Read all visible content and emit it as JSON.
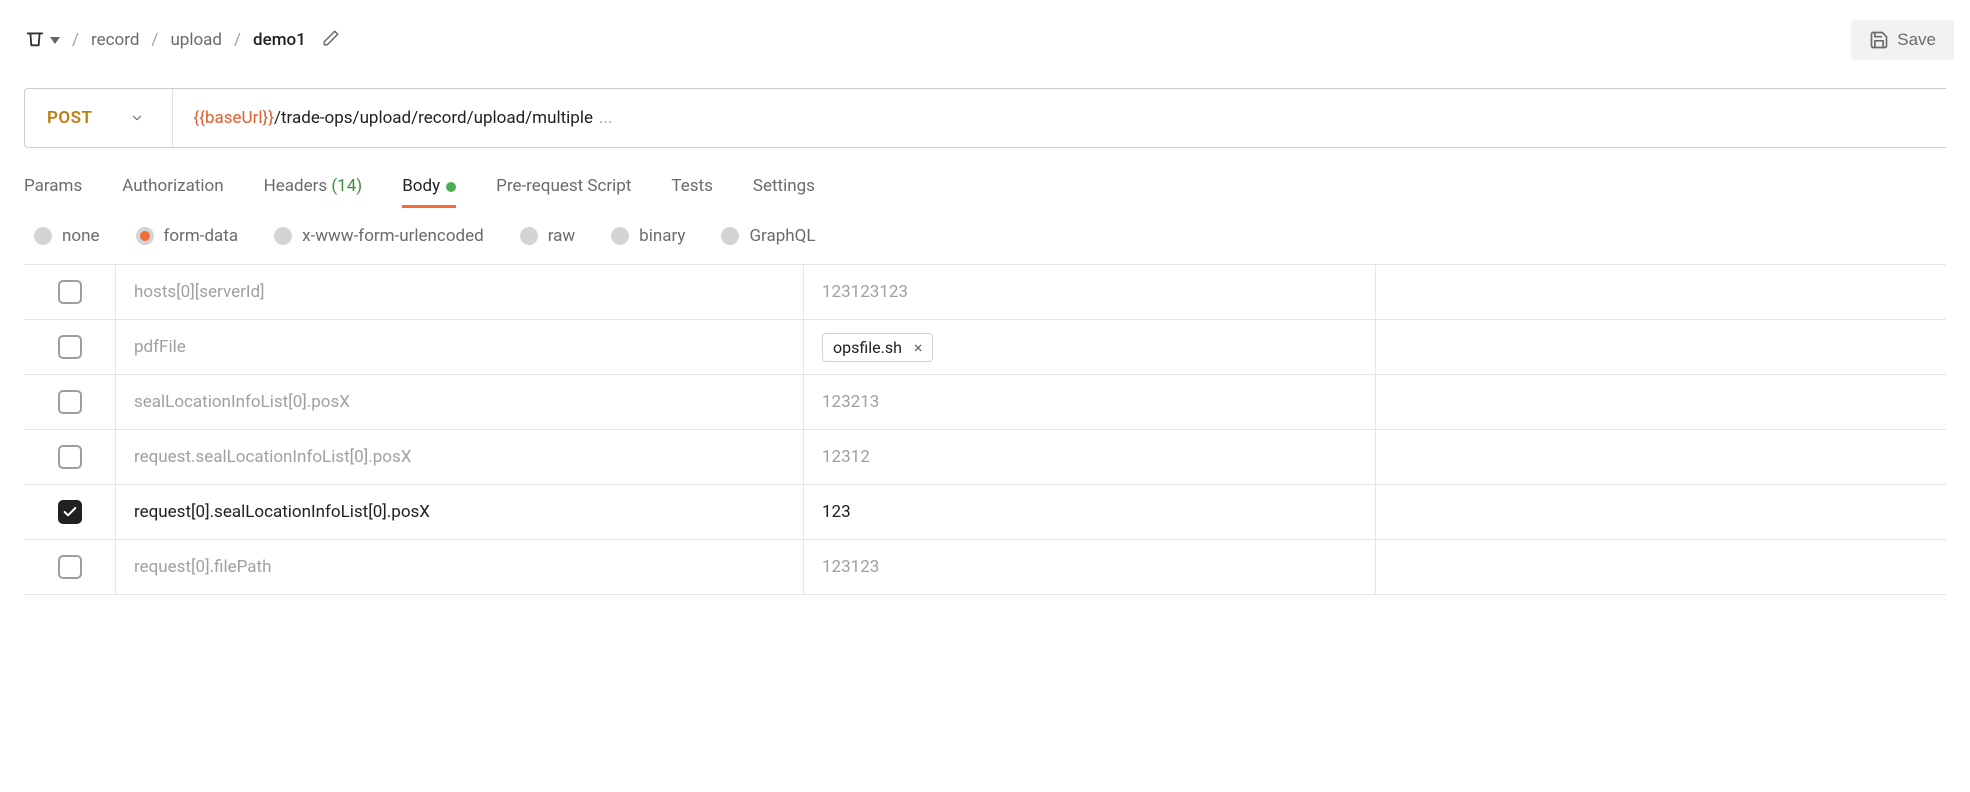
{
  "breadcrumb": {
    "items": [
      "record",
      "upload",
      "demo1"
    ]
  },
  "save_label": "Save",
  "request": {
    "method": "POST",
    "url_var": "{{baseUrl}}",
    "url_path": "/trade-ops/upload/record/upload/multiple",
    "url_ellipsis": "..."
  },
  "tabs": {
    "params": "Params",
    "authorization": "Authorization",
    "headers": "Headers",
    "headers_count": "(14)",
    "body": "Body",
    "prerequest": "Pre-request Script",
    "tests": "Tests",
    "settings": "Settings",
    "active": "body"
  },
  "body_types": {
    "none": "none",
    "form_data": "form-data",
    "urlencoded": "x-www-form-urlencoded",
    "raw": "raw",
    "binary": "binary",
    "graphql": "GraphQL",
    "selected": "form_data"
  },
  "form_rows": [
    {
      "checked": false,
      "key": "hosts[0][serverId]",
      "value": "123123123",
      "type": "text"
    },
    {
      "checked": false,
      "key": "pdfFile",
      "value": "opsfile.sh",
      "type": "file"
    },
    {
      "checked": false,
      "key": "sealLocationInfoList[0].posX",
      "value": "123213",
      "type": "text"
    },
    {
      "checked": false,
      "key": "request.sealLocationInfoList[0].posX",
      "value": "12312",
      "type": "text"
    },
    {
      "checked": true,
      "key": "request[0].sealLocationInfoList[0].posX",
      "value": "123",
      "type": "text"
    },
    {
      "checked": false,
      "key": "request[0].filePath",
      "value": "123123",
      "type": "text"
    }
  ]
}
